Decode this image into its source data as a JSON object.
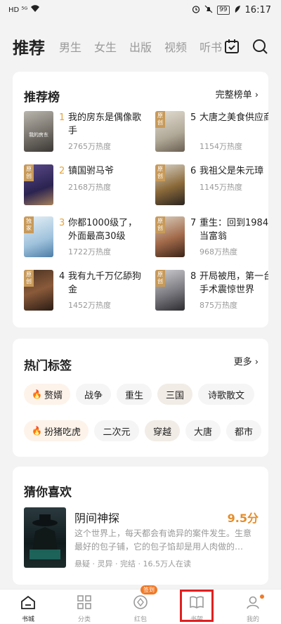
{
  "status": {
    "left": "HD ⁵ᴳ",
    "battery": "99",
    "time": "16:17"
  },
  "topnav": {
    "active": "推荐",
    "tabs": [
      "男生",
      "女生",
      "出版",
      "视频",
      "听书"
    ]
  },
  "ranking": {
    "title": "推荐榜",
    "more": "完整榜单 ›",
    "items": [
      {
        "no": "1",
        "title": "我的房东是偶像歌手",
        "heat": "2765万热度",
        "tag": ""
      },
      {
        "no": "2",
        "title": "镇国驸马爷",
        "heat": "2168万热度",
        "tag": "原创"
      },
      {
        "no": "3",
        "title": "你都1000级了，外面最高30级",
        "heat": "1722万热度",
        "tag": "独家"
      },
      {
        "no": "4",
        "title": "我有九千万亿舔狗金",
        "heat": "1452万热度",
        "tag": "原创"
      },
      {
        "no": "5",
        "title": "大唐之美食供应商",
        "heat": "1154万热度",
        "tag": "原创"
      },
      {
        "no": "6",
        "title": "我祖父是朱元璋",
        "heat": "1145万热度",
        "tag": "原创"
      },
      {
        "no": "7",
        "title": "重生：回到1984当富翁",
        "heat": "968万热度",
        "tag": "原创"
      },
      {
        "no": "8",
        "title": "开局被甩，第一台手术震惊世界",
        "heat": "875万热度",
        "tag": "原创"
      }
    ]
  },
  "tags": {
    "title": "热门标签",
    "more": "更多 ›",
    "row1": [
      "赘婿",
      "战争",
      "重生",
      "三国",
      "诗歌散文"
    ],
    "row2": [
      "扮猪吃虎",
      "二次元",
      "穿越",
      "大唐",
      "都市"
    ]
  },
  "guess": {
    "title": "猜你喜欢",
    "book_title": "阴间神探",
    "score": "9.5分",
    "desc": "这个世界上，每天都会有诡异的案件发生。生意最好的包子铺，它的包子馅却是用人肉做的…",
    "meta": "悬疑 · 灵异 · 完结 · 16.5万人在读"
  },
  "bottomnav": {
    "items": [
      "书城",
      "分类",
      "红包",
      "书架",
      "我的"
    ],
    "badge": "签到"
  }
}
